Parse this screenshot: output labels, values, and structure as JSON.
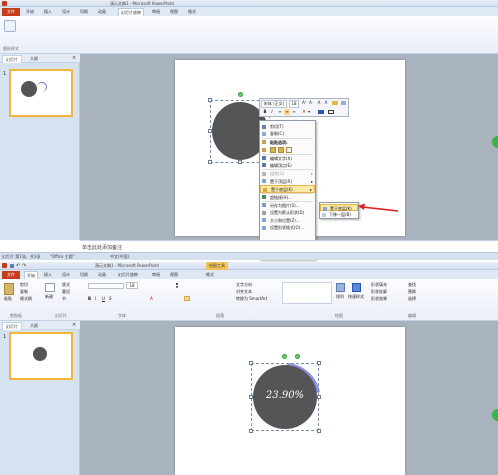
{
  "window_top": {
    "title": "演示文稿1 - Microsoft PowerPoint",
    "tabs": [
      "文件",
      "开始",
      "插入",
      "设计",
      "切换",
      "动画",
      "幻灯片放映",
      "审阅",
      "视图",
      "格式"
    ],
    "ribbon_group_label": "图形样式",
    "panel_tabs": [
      "幻灯片",
      "大纲"
    ],
    "thumb_number": "1",
    "notes_placeholder": "单击此处添加备注",
    "status": {
      "slide": "幻灯片 第1张，共1张",
      "theme": "\"Office 主题\"",
      "lang": "中文(中国)"
    },
    "mini_toolbar": {
      "font": "宋体 (正文)",
      "size": "18",
      "row1_buttons": [
        "A⁺",
        "A⁻",
        "A",
        "A",
        "A"
      ],
      "row2_buttons": [
        "B",
        "I",
        "≡",
        "≡",
        "≡",
        "A",
        "▾"
      ]
    },
    "context_menu": [
      {
        "label": "剪切(T)",
        "icon": "scissors-icon",
        "disabled": false
      },
      {
        "label": "复制(C)",
        "icon": "copy-icon",
        "disabled": false
      },
      {
        "label": "粘贴选项:",
        "icon": "clipboard-icon",
        "disabled": false,
        "bold": true
      },
      {
        "label": "",
        "icon": "paste-options-icon",
        "disabled": false,
        "paste_row": true
      },
      {
        "label": "编辑文字(X)",
        "icon": "edit-text-icon",
        "disabled": false
      },
      {
        "label": "编辑顶点(E)",
        "icon": "edit-points-icon",
        "disabled": false
      },
      {
        "label": "组合(G)",
        "icon": "group-icon",
        "disabled": true,
        "arrow": true
      },
      {
        "label": "置于顶层(R)",
        "icon": "bring-front-icon",
        "disabled": false,
        "arrow": true
      },
      {
        "label": "置于底层(K)",
        "icon": "send-back-icon",
        "disabled": false,
        "arrow": true,
        "highlight": true
      },
      {
        "label": "超链接(H)...",
        "icon": "hyperlink-icon",
        "disabled": false
      },
      {
        "label": "另存为图片(S)...",
        "icon": "save-picture-icon",
        "disabled": false
      },
      {
        "label": "设置为默认形状(D)",
        "icon": "default-shape-icon",
        "disabled": false
      },
      {
        "label": "大小和位置(Z)...",
        "icon": "size-position-icon",
        "disabled": false
      },
      {
        "label": "设置形状格式(O)...",
        "icon": "format-shape-icon",
        "disabled": false
      }
    ],
    "submenu": [
      {
        "label": "置于底层(K)",
        "highlight": true
      },
      {
        "label": "下移一层(B)",
        "highlight": false
      }
    ]
  },
  "window_bottom": {
    "title": "演示文稿1 - Microsoft PowerPoint",
    "context_tool": "绘图工具",
    "tabs": [
      "文件",
      "开始",
      "插入",
      "设计",
      "切换",
      "动画",
      "幻灯片放映",
      "审阅",
      "视图",
      "格式"
    ],
    "clipboard": {
      "paste": "粘贴",
      "cut": "剪切",
      "copy": "复制",
      "format": "格式刷",
      "label": "剪贴板"
    },
    "slides": {
      "new": "新建",
      "layout": "版式",
      "reset": "重设",
      "section": "节",
      "label": "幻灯片"
    },
    "font": {
      "size": "18",
      "label": "字体"
    },
    "paragraph": {
      "text_dir": "文字方向",
      "align": "对齐文本",
      "smartart": "转换为 SmartArt",
      "label": "段落"
    },
    "drawing": {
      "arrange": "排列",
      "quick_styles": "快速样式",
      "fill": "形状填充",
      "outline": "形状轮廓",
      "effects": "形状效果",
      "label": "绘图"
    },
    "editing": {
      "find": "查找",
      "replace": "替换",
      "select": "选择",
      "label": "编辑"
    },
    "panel_tabs": [
      "幻灯片",
      "大纲"
    ],
    "thumb_number": "1",
    "shape_text": "23.90%"
  },
  "colors": {
    "accent": "#f3b53a",
    "file_tab": "#c43c1a",
    "circle": "#555558",
    "arc": "#8e8ee8",
    "arrow": "#e02020"
  }
}
